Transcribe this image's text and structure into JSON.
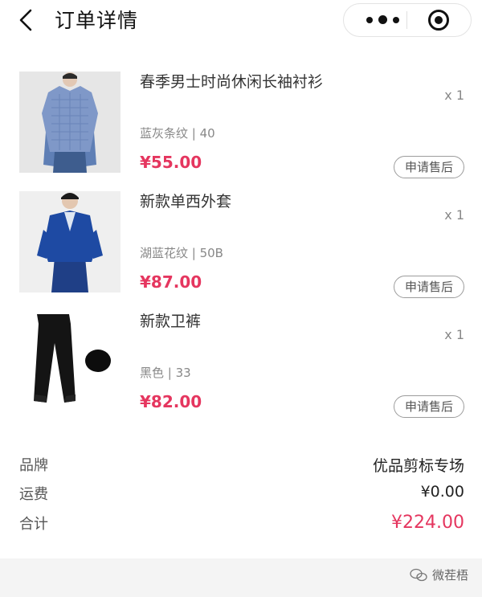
{
  "header": {
    "title": "订单详情",
    "back_icon": "chevron-left-icon",
    "more_icon": "more-dots-icon",
    "target_icon": "target-icon"
  },
  "products": [
    {
      "name": "春季男士时尚休闲长袖衬衫",
      "spec": "蓝灰条纹 | 40",
      "price": "¥55.00",
      "qty": "x 1",
      "action": "申请售后",
      "image": "blue-checked-shirt-photo"
    },
    {
      "name": "新款单西外套",
      "spec": "湖蓝花纹 | 50B",
      "price": "¥87.00",
      "qty": "x 1",
      "action": "申请售后",
      "image": "blue-blazer-photo"
    },
    {
      "name": "新款卫裤",
      "spec": "黑色 | 33",
      "price": "¥82.00",
      "qty": "x 1",
      "action": "申请售后",
      "image": "black-jogger-pants-photo"
    }
  ],
  "summary": {
    "brand_label": "品牌",
    "brand_value": "优品剪标专场",
    "shipping_label": "运费",
    "shipping_value": "¥0.00",
    "total_label": "合计",
    "total_value": "¥224.00"
  },
  "watermark": {
    "text": "微茬梧",
    "icon": "wechat-icon"
  },
  "colors": {
    "price": "#e5365f",
    "text": "#333333",
    "muted": "#888888"
  }
}
